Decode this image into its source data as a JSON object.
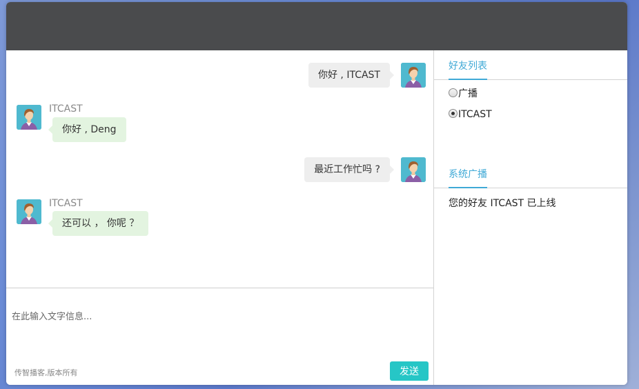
{
  "messages": [
    {
      "side": "me",
      "text": "你好 , ITCAST"
    },
    {
      "side": "other",
      "sender": "ITCAST",
      "text": "你好 , Deng"
    },
    {
      "side": "me",
      "text": "最近工作忙吗 ?"
    },
    {
      "side": "other",
      "sender": "ITCAST",
      "text": "还可以 ， 你呢 ？"
    }
  ],
  "compose": {
    "placeholder": "在此输入文字信息...",
    "copyright": "传智播客,版本所有",
    "send_label": "发送"
  },
  "friends_section": {
    "title": "好友列表",
    "items": [
      {
        "label": "广播",
        "checked": false
      },
      {
        "label": "ITCAST",
        "checked": true
      }
    ]
  },
  "broadcast_section": {
    "title": "系统广播",
    "notice": "您的好友 ITCAST 已上线"
  },
  "colors": {
    "titlebar": "#4a4b4d",
    "accent": "#3fa9d6",
    "send_button": "#26c6c6",
    "my_bubble": "#eeeeee",
    "other_bubble": "#e3f4e0",
    "avatar_bg": "#4fb9cf"
  },
  "icons": {
    "avatar": "user-avatar-icon",
    "radio": "radio-icon"
  }
}
